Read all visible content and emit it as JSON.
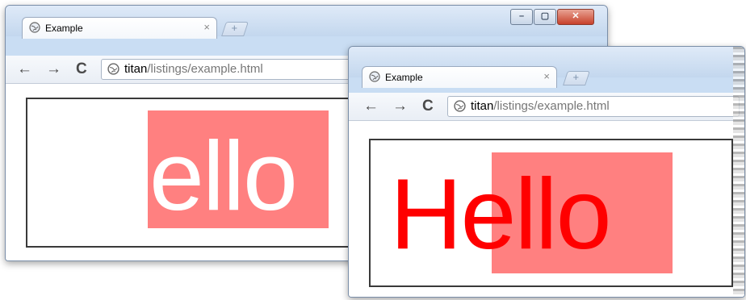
{
  "back_window": {
    "tab_title": "Example",
    "tab_close": "×",
    "new_tab": "+",
    "window_controls": {
      "minimize": "–",
      "maximize": "▢",
      "close": "✕"
    },
    "nav": {
      "back": "←",
      "forward": "→",
      "reload": "C"
    },
    "url_host": "titan",
    "url_path": "/listings/example.html",
    "page": {
      "visible_text": "ello",
      "highlight_color": "#ff8080",
      "text_color": "#ffffff"
    }
  },
  "front_window": {
    "tab_title": "Example",
    "tab_close": "×",
    "new_tab": "+",
    "nav": {
      "back": "←",
      "forward": "→",
      "reload": "C"
    },
    "url_host": "titan",
    "url_path": "/listings/example.html",
    "page": {
      "text": "Hello",
      "highlight_color": "#ff8080",
      "text_color": "#ff0000"
    }
  },
  "icons": {
    "favicon": "globe-icon",
    "omnibox": "globe-icon"
  },
  "colors": {
    "frame": "#c9ddf3",
    "accent_close": "#c7412b"
  }
}
